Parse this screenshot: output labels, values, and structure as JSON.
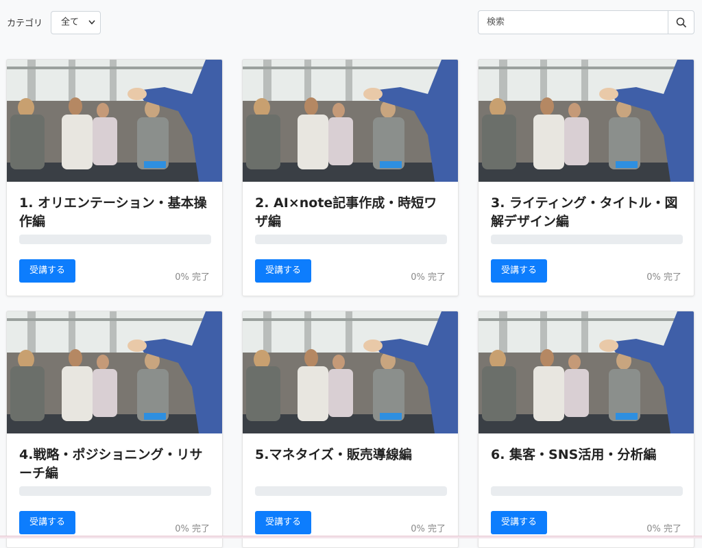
{
  "filter": {
    "category_label": "カテゴリ",
    "category_selected": "全て"
  },
  "search": {
    "placeholder": "検索"
  },
  "courses": [
    {
      "title": "1. オリエンテーション・基本操作編",
      "button_label": "受講する",
      "progress_text": "0% 完了",
      "progress": 0
    },
    {
      "title": "2. AI×note記事作成・時短ワザ編",
      "button_label": "受講する",
      "progress_text": "0% 完了",
      "progress": 0
    },
    {
      "title": "3. ライティング・タイトル・図解デザイン編",
      "button_label": "受講する",
      "progress_text": "0% 完了",
      "progress": 0
    },
    {
      "title": "4.戦略・ポジショニング・リサーチ編",
      "button_label": "受講する",
      "progress_text": "0% 完了",
      "progress": 0
    },
    {
      "title": "5.マネタイズ・販売導線編",
      "button_label": "受講する",
      "progress_text": "0% 完了",
      "progress": 0
    },
    {
      "title": "6. 集客・SNS活用・分析編",
      "button_label": "受講する",
      "progress_text": "0% 完了",
      "progress": 0
    }
  ],
  "colors": {
    "accent": "#0d7dfd",
    "progress_track": "#e9ecef",
    "background": "#f8f9fa"
  }
}
